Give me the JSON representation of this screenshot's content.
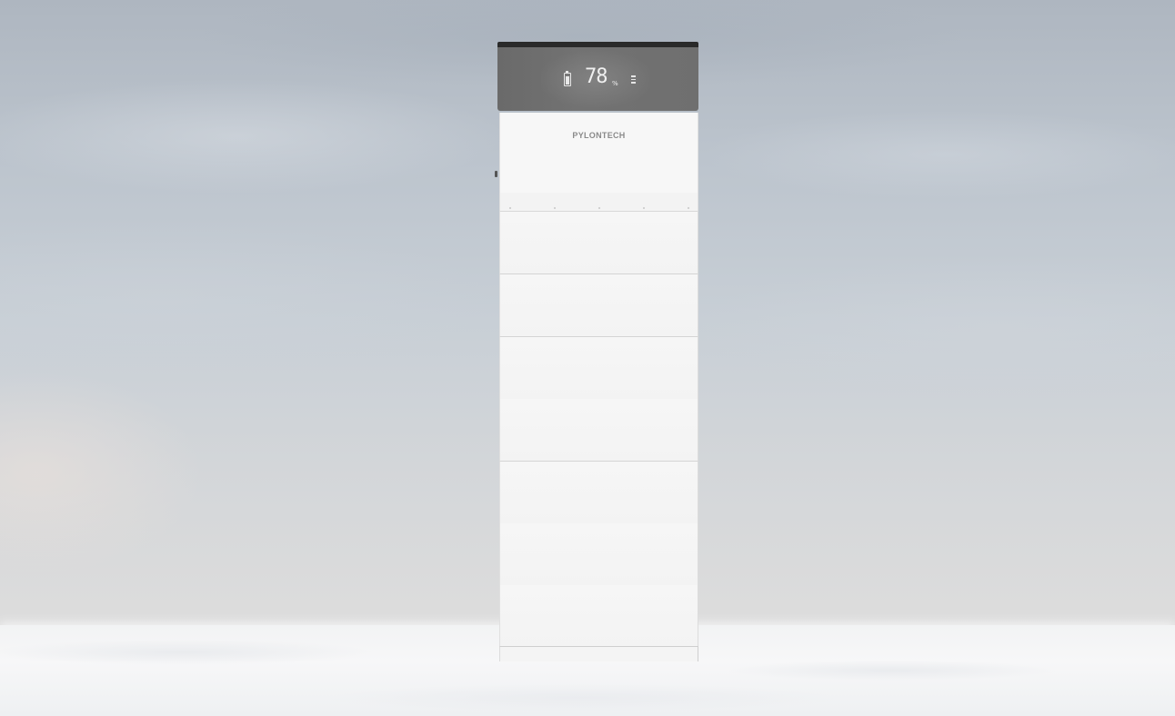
{
  "scene": {
    "description_colors": {
      "sky_top": "#aeb6c0",
      "sky_bottom": "#e6e6e8",
      "snow": "#f4f5f6",
      "display_panel": "#6f6f6f",
      "cap": "#2a2a2a",
      "module_white": "#f5f5f5"
    }
  },
  "battery": {
    "brand": "PYLONTECH",
    "display": {
      "soc_value": "78",
      "soc_unit": "%",
      "soc_level": 0.78,
      "battery_icon": "battery-icon",
      "status_icon": "status-bars-icon"
    }
  }
}
